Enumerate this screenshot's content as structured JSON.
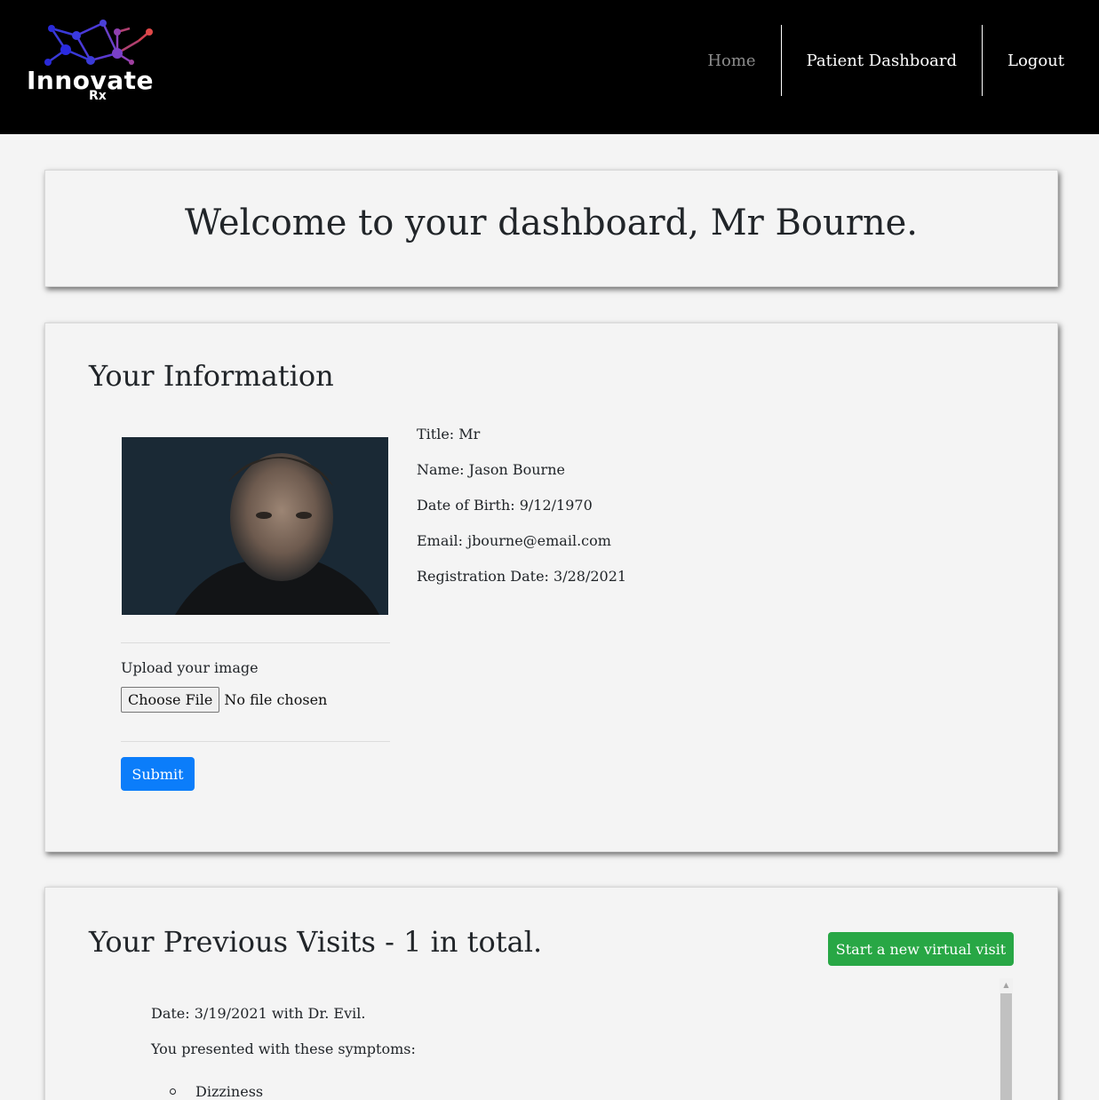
{
  "header": {
    "logo_text": "Innovate",
    "logo_sub": "Rx",
    "nav": [
      {
        "label": "Home"
      },
      {
        "label": "Patient Dashboard"
      },
      {
        "label": "Logout"
      }
    ],
    "colors": {
      "background": "#000000",
      "muted": "#8c8c8c"
    }
  },
  "welcome": {
    "title": "Welcome to your dashboard, Mr Bourne."
  },
  "info": {
    "title": "Your Information",
    "photo_icon": "patient-photo",
    "fields": [
      {
        "text": "Title: Mr"
      },
      {
        "text": "Name: Jason Bourne"
      },
      {
        "text": "Date of Birth: 9/12/1970"
      },
      {
        "text": "Email: jbourne@email.com"
      },
      {
        "text": "Registration Date: 3/28/2021"
      }
    ],
    "upload_label": "Upload your image",
    "choose_file": "Choose File",
    "file_status": "No file chosen",
    "submit": "Submit",
    "submit_color": "#0b7dfa"
  },
  "visits": {
    "title": "Your Previous Visits - 1 in total.",
    "new_visit_button": "Start a new virtual visit",
    "new_visit_color": "#28a745",
    "items": [
      {
        "date_line": "Date: 3/19/2021 with Dr. Evil.",
        "symptoms_intro": "You presented with these symptoms:",
        "symptoms": [
          "Dizziness"
        ]
      }
    ]
  }
}
